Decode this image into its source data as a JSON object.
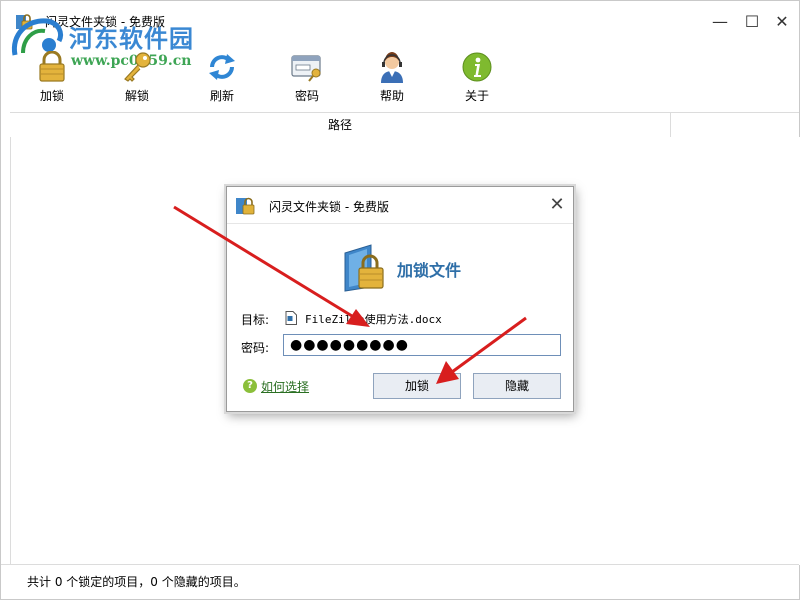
{
  "window": {
    "title": "闪灵文件夹锁 - 免费版",
    "controls": {
      "minimize": "—",
      "maximize": "☐",
      "close": "✕"
    }
  },
  "watermark": {
    "name": "河东软件园",
    "url": "www.pc0359.cn"
  },
  "toolbar": {
    "items": [
      {
        "label": "加锁",
        "icon": "lock-icon"
      },
      {
        "label": "解锁",
        "icon": "key-icon"
      },
      {
        "label": "刷新",
        "icon": "refresh-icon"
      },
      {
        "label": "密码",
        "icon": "password-card-icon"
      },
      {
        "label": "帮助",
        "icon": "support-agent-icon"
      },
      {
        "label": "关于",
        "icon": "info-icon"
      }
    ]
  },
  "list": {
    "columns": [
      "路径"
    ]
  },
  "statusbar": {
    "text": "共计 0 个锁定的项目，0 个隐藏的项目。"
  },
  "dialog": {
    "title": "闪灵文件夹锁 - 免费版",
    "heading": "加锁文件",
    "target_label": "目标:",
    "target_value": "FileZilla使用方法.docx",
    "password_label": "密码:",
    "password_value": "●●●●●●●●●",
    "help_link": "如何选择",
    "lock_button": "加锁",
    "hide_button": "隐藏",
    "close": "✕"
  },
  "colors": {
    "heading": "#2f6fa8",
    "link": "#2a6f22",
    "arrow": "#d81e1e",
    "watermark_blue": "#2a7ed0",
    "watermark_green": "#2e9e47"
  }
}
